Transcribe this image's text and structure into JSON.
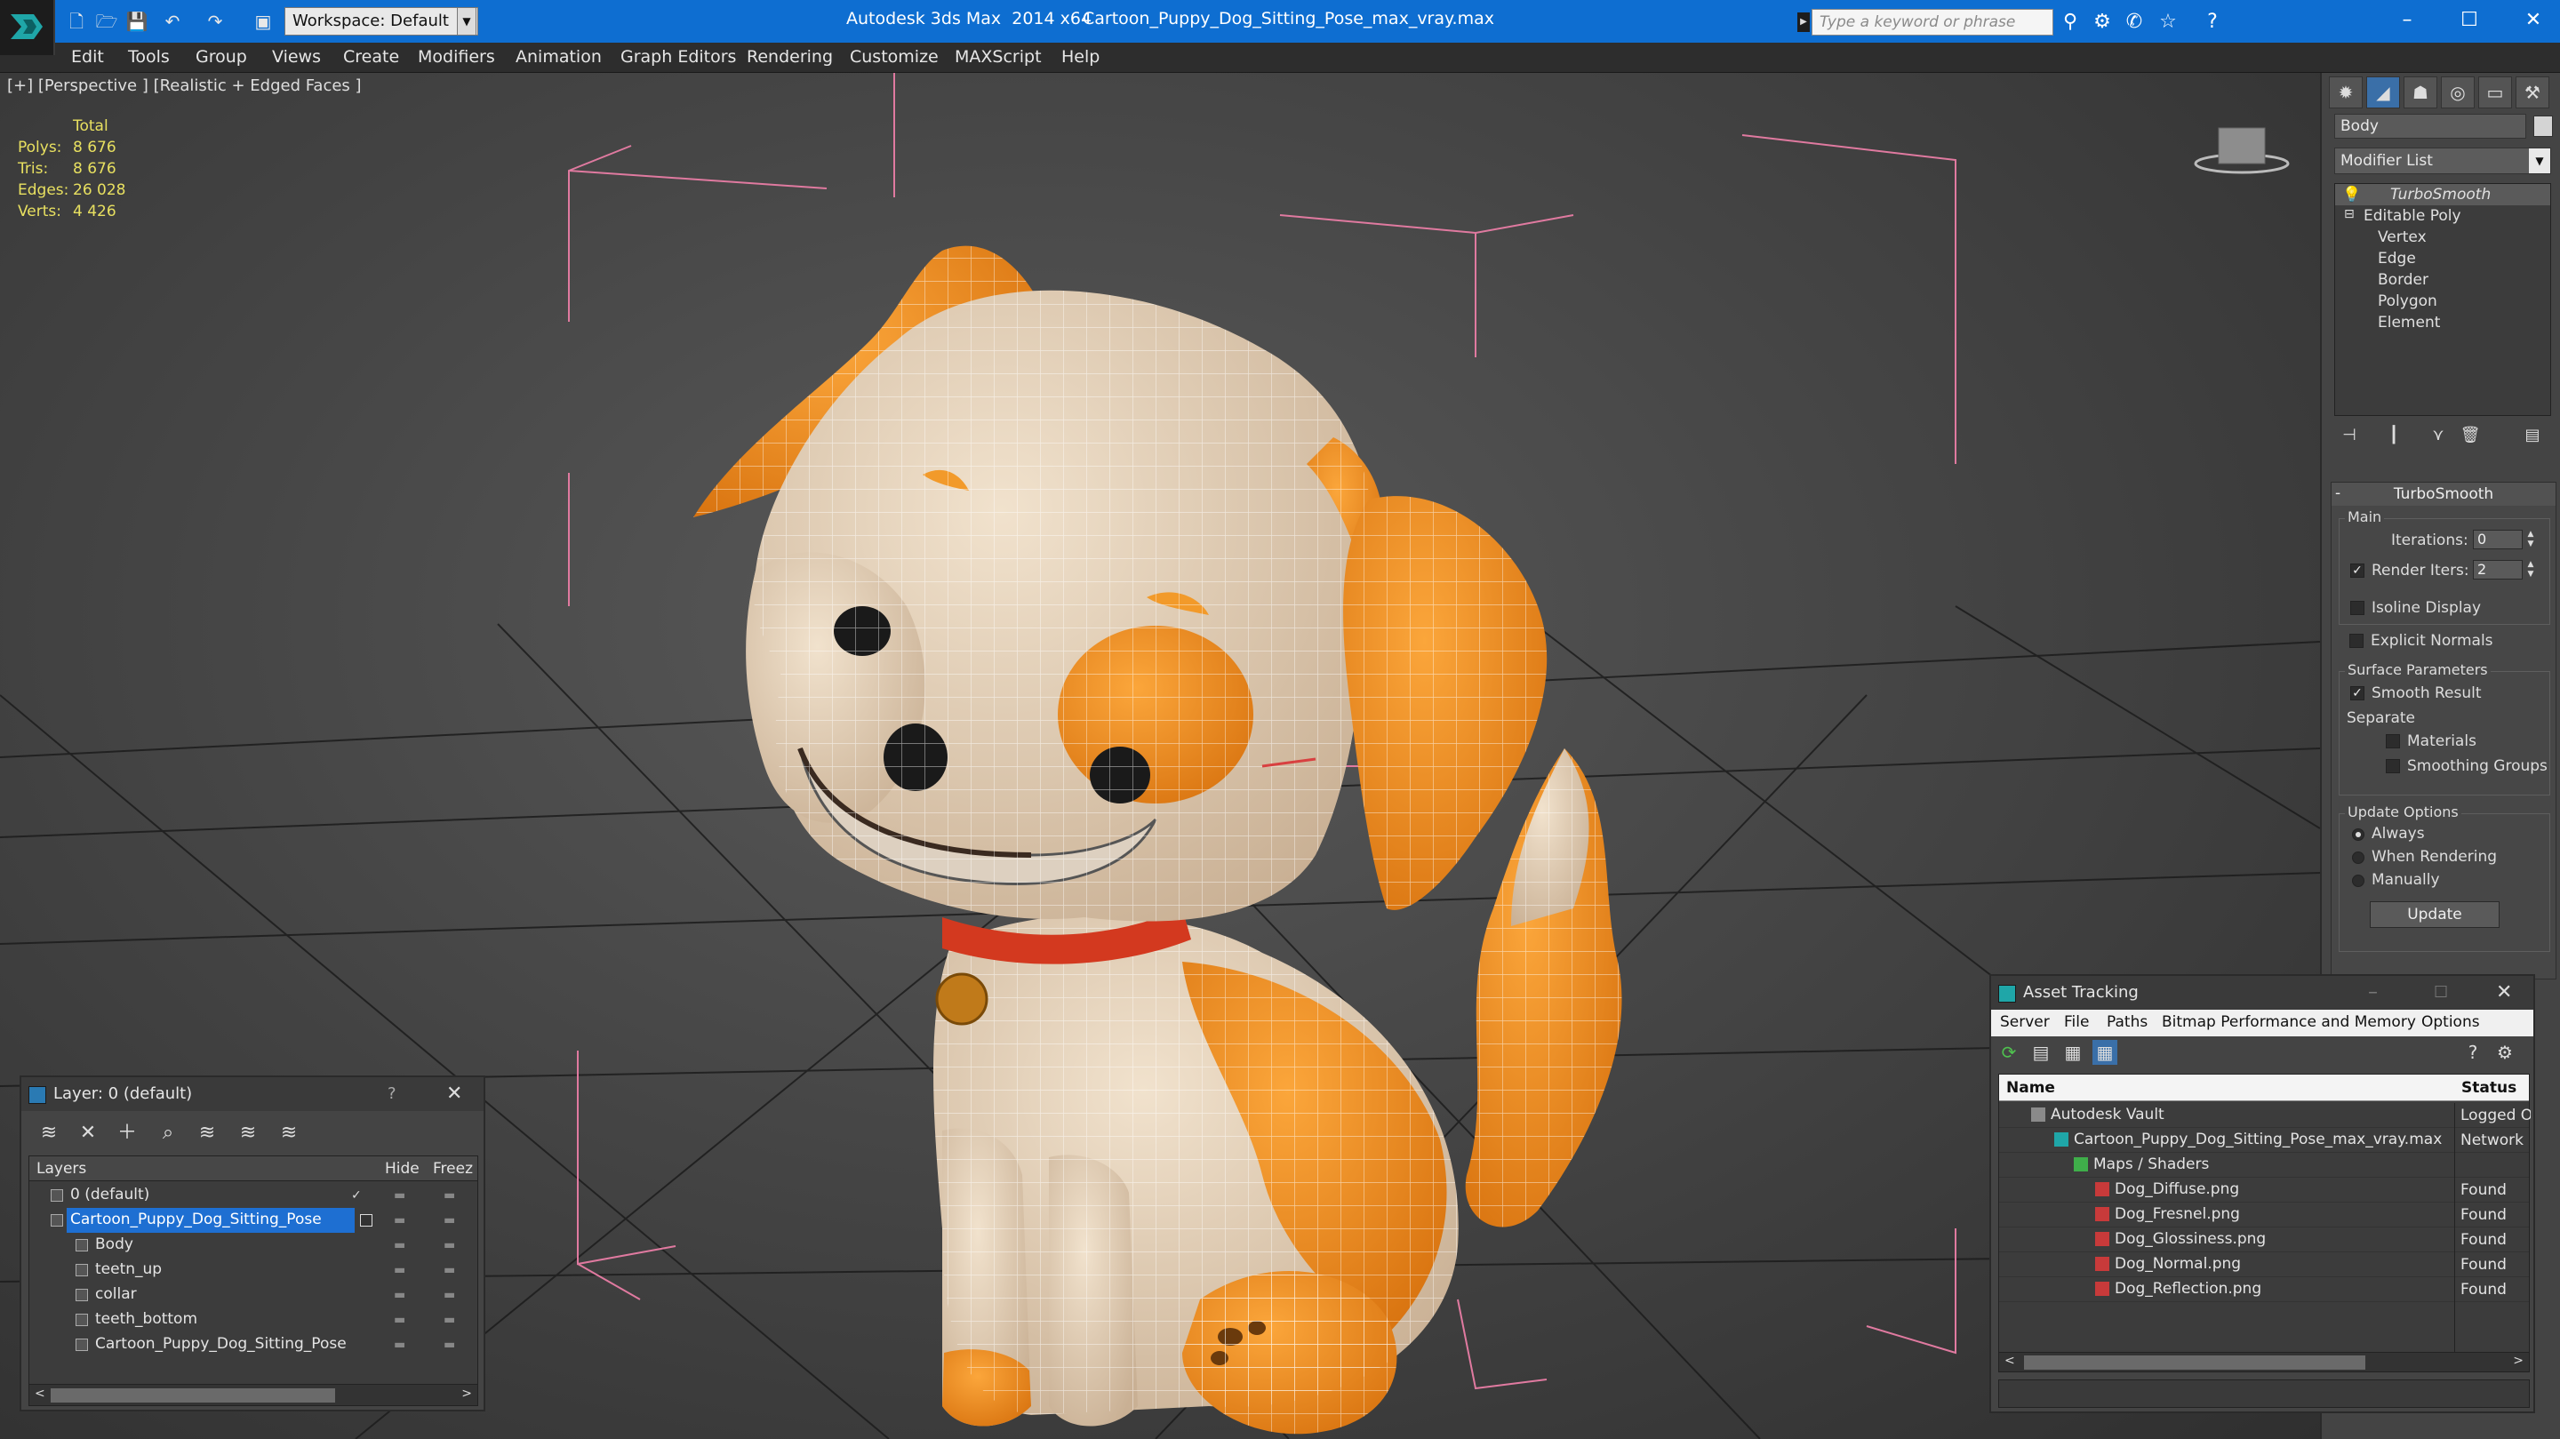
{
  "titlebar": {
    "app_title": "Autodesk 3ds Max  2014 x64",
    "document": "Cartoon_Puppy_Dog_Sitting_Pose_max_vray.max",
    "workspace": "Workspace: Default",
    "search_placeholder": "Type a keyword or phrase"
  },
  "menu": [
    "Edit",
    "Tools",
    "Group",
    "Views",
    "Create",
    "Modifiers",
    "Animation",
    "Graph Editors",
    "Rendering",
    "Customize",
    "MAXScript",
    "Help"
  ],
  "viewport": {
    "label": "[+] [Perspective ] [Realistic + Edged Faces ]",
    "stats": {
      "total_label": "Total",
      "rows": [
        {
          "key": "Polys:",
          "value": "8 676"
        },
        {
          "key": "Tris:",
          "value": "8 676"
        },
        {
          "key": "Edges:",
          "value": "26 028"
        },
        {
          "key": "Verts:",
          "value": "4 426"
        }
      ]
    }
  },
  "command_panel": {
    "object_name": "Body",
    "modifier_list": "Modifier List",
    "stack": [
      "TurboSmooth",
      "Editable Poly",
      "Vertex",
      "Edge",
      "Border",
      "Polygon",
      "Element"
    ],
    "turbosmooth": {
      "header": "TurboSmooth",
      "main_label": "Main",
      "iterations_label": "Iterations:",
      "iterations_value": "0",
      "render_iters_label": "Render Iters:",
      "render_iters_value": "2",
      "isoline_label": "Isoline Display",
      "explicit_normals_label": "Explicit Normals",
      "surface_params_label": "Surface Parameters",
      "smooth_result_label": "Smooth Result",
      "separate_label": "Separate",
      "materials_label": "Materials",
      "smoothing_groups_label": "Smoothing Groups",
      "update_options_label": "Update Options",
      "always_label": "Always",
      "when_rendering_label": "When Rendering",
      "manually_label": "Manually",
      "update_button": "Update"
    }
  },
  "layer_panel": {
    "title": "Layer: 0 (default)",
    "help": "?",
    "columns": [
      "Layers",
      "Hide",
      "Freez"
    ],
    "rows": [
      {
        "name": "0 (default)",
        "level": 0
      },
      {
        "name": "Cartoon_Puppy_Dog_Sitting_Pose",
        "level": 0
      },
      {
        "name": "Body",
        "level": 1
      },
      {
        "name": "teetn_up",
        "level": 1
      },
      {
        "name": "collar",
        "level": 1
      },
      {
        "name": "teeth_bottom",
        "level": 1
      },
      {
        "name": "Cartoon_Puppy_Dog_Sitting_Pose",
        "level": 1
      }
    ]
  },
  "asset_tracking": {
    "title": "Asset Tracking",
    "menu": [
      "Server",
      "File",
      "Paths",
      "Bitmap Performance and Memory",
      "Options"
    ],
    "columns": [
      "Name",
      "Status"
    ],
    "rows": [
      {
        "name": "Autodesk Vault",
        "status": "Logged O",
        "level": 1
      },
      {
        "name": "Cartoon_Puppy_Dog_Sitting_Pose_max_vray.max",
        "status": "Network",
        "level": 2
      },
      {
        "name": "Maps / Shaders",
        "status": "",
        "level": 3
      },
      {
        "name": "Dog_Diffuse.png",
        "status": "Found",
        "level": 4
      },
      {
        "name": "Dog_Fresnel.png",
        "status": "Found",
        "level": 4
      },
      {
        "name": "Dog_Glossiness.png",
        "status": "Found",
        "level": 4
      },
      {
        "name": "Dog_Normal.png",
        "status": "Found",
        "level": 4
      },
      {
        "name": "Dog_Reflection.png",
        "status": "Found",
        "level": 4
      }
    ]
  },
  "colors": {
    "titlebar": "#0e6ed1",
    "selection": "#1e6fd2",
    "stats_text": "#e8e060",
    "dog_orange": "#f28f1e",
    "dog_cream": "#e9d5bb",
    "collar_red": "#d3391f"
  }
}
